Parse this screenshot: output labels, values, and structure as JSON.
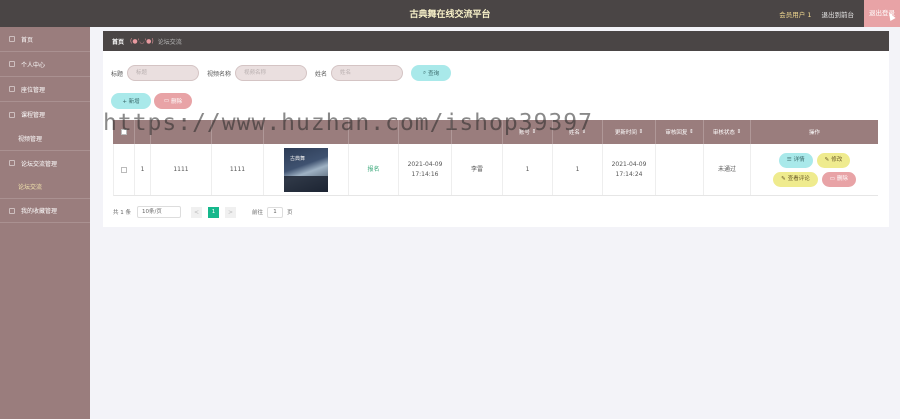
{
  "header": {
    "title": "古典舞在线交流平台",
    "user": "会员用户 1",
    "back_home": "退出到前台",
    "logout": "退出登录"
  },
  "sidebar": {
    "items": [
      {
        "label": "首页"
      },
      {
        "label": "个人中心"
      },
      {
        "label": "座位管理"
      },
      {
        "label": "课程管理"
      },
      {
        "label": "视频管理"
      },
      {
        "label": "论坛交流管理"
      },
      {
        "label": "论坛交流"
      },
      {
        "label": "我的收藏管理"
      }
    ]
  },
  "breadcrumb": {
    "home": "首页",
    "emoticon": "(●'◡'●)",
    "current": "论坛交流"
  },
  "search": {
    "title_label": "标题",
    "title_placeholder": "标题",
    "video_label": "视频名称",
    "video_placeholder": "视频名称",
    "name_label": "姓名",
    "name_placeholder": "姓名",
    "query_button": "查询"
  },
  "actions": {
    "add": "+ 新增",
    "delete": "删除"
  },
  "table": {
    "headers": [
      "",
      "",
      "",
      "",
      "",
      "",
      "",
      "",
      "账号",
      "姓名",
      "更新时间",
      "审核回复",
      "审核状态",
      "操作"
    ],
    "row": {
      "index": "1",
      "title": "1111",
      "video": "1111",
      "type": "报名",
      "time": "2021-04-09 17:14:16",
      "name_col": "李雷",
      "account": "1",
      "realname": "1",
      "updated": "2021-04-09 17:14:24",
      "reply": "",
      "status": "未通过",
      "thumb_text": "古典舞"
    },
    "ops": {
      "detail": "详情",
      "edit": "修改",
      "comments": "查看评论",
      "delete": "删除"
    }
  },
  "pager": {
    "total": "共 1 条",
    "page_size": "10条/页",
    "prev": "<",
    "current": "1",
    "next": ">",
    "goto_label": "前往",
    "goto_value": "1",
    "page_suffix": "页"
  },
  "watermark": "https://www.huzhan.com/ishop39397"
}
